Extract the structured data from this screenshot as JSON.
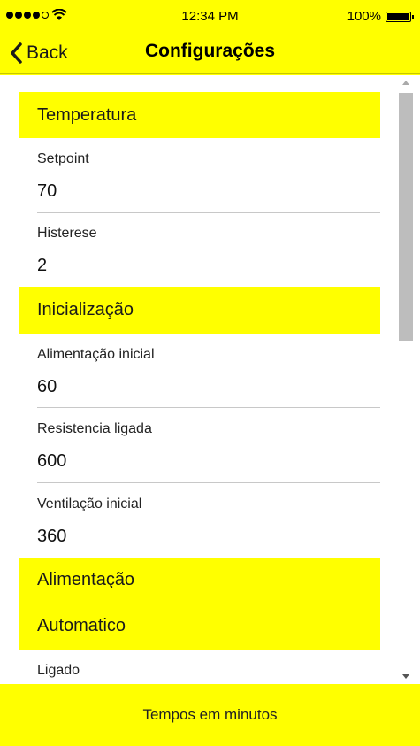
{
  "status_bar": {
    "time": "12:34 PM",
    "battery": "100%"
  },
  "nav": {
    "back_label": "Back",
    "title": "Configurações"
  },
  "sections": {
    "temperatura": {
      "title": "Temperatura",
      "setpoint": {
        "label": "Setpoint",
        "value": "70"
      },
      "histerese": {
        "label": "Histerese",
        "value": "2"
      }
    },
    "inicializacao": {
      "title": "Inicialização",
      "alimentacao_inicial": {
        "label": "Alimentação inicial",
        "value": "60"
      },
      "resistencia_ligada": {
        "label": "Resistencia ligada",
        "value": "600"
      },
      "ventilacao_inicial": {
        "label": "Ventilação inicial",
        "value": "360"
      }
    },
    "alimentacao": {
      "title": "Alimentação",
      "subtitle": "Automatico",
      "ligado": {
        "label": "Ligado"
      }
    }
  },
  "footer": {
    "text": "Tempos em minutos"
  },
  "colors": {
    "accent": "#ffff00",
    "background": "#ffffff"
  }
}
